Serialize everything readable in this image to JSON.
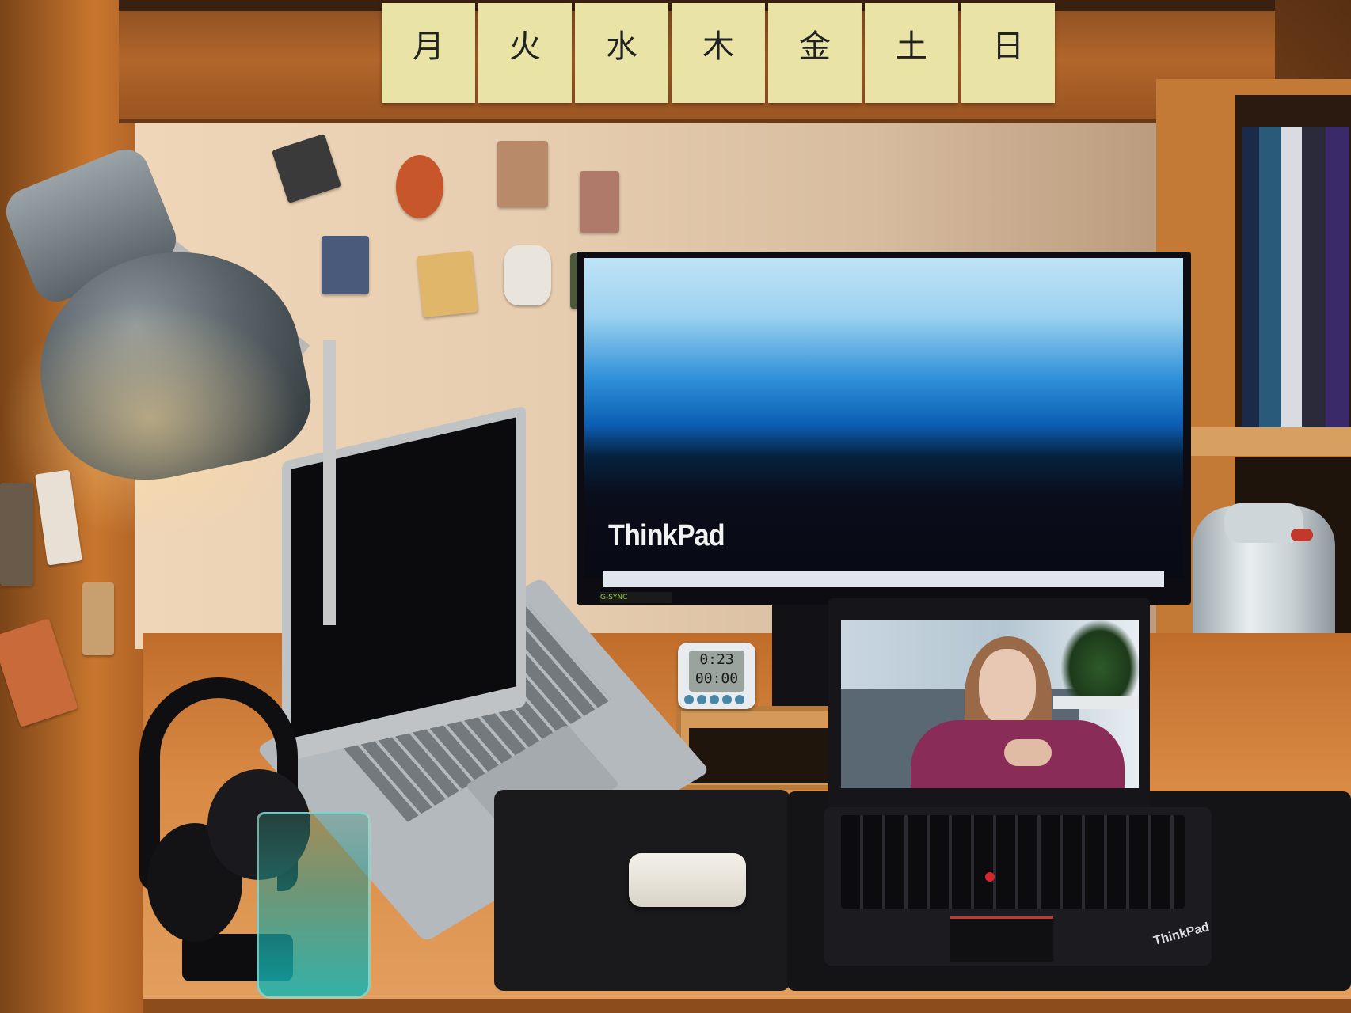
{
  "scene": {
    "weekday_notes": [
      "月",
      "火",
      "水",
      "木",
      "金",
      "土",
      "日"
    ],
    "monitor": {
      "logo": "ThinkPad",
      "badge": "G-SYNC"
    },
    "timer": {
      "line1": "0:23",
      "line2": "00:00"
    },
    "laptop_front": {
      "logo": "ThinkPad"
    }
  }
}
